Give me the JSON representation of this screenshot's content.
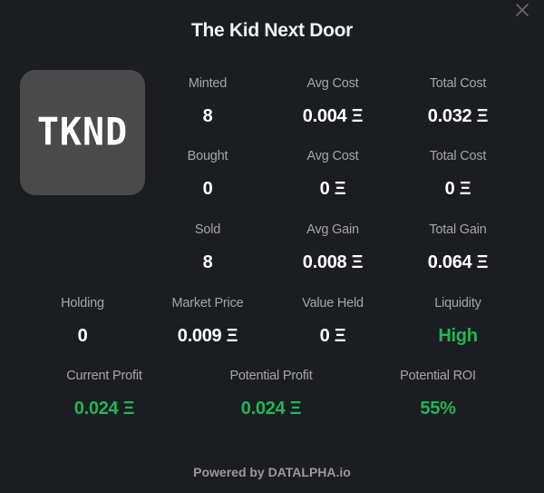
{
  "title": "The Kid Next Door",
  "logo_text": "TKND",
  "close_icon": "close-icon",
  "minted": {
    "count_label": "Minted",
    "count_value": "8",
    "avg_label": "Avg Cost",
    "avg_value": "0.004 Ξ",
    "total_label": "Total Cost",
    "total_value": "0.032 Ξ"
  },
  "bought": {
    "count_label": "Bought",
    "count_value": "0",
    "avg_label": "Avg Cost",
    "avg_value": "0 Ξ",
    "total_label": "Total Cost",
    "total_value": "0 Ξ"
  },
  "sold": {
    "count_label": "Sold",
    "count_value": "8",
    "avg_label": "Avg Gain",
    "avg_value": "0.008 Ξ",
    "total_label": "Total Gain",
    "total_value": "0.064 Ξ"
  },
  "holding": {
    "holding_label": "Holding",
    "holding_value": "0",
    "market_label": "Market Price",
    "market_value": "0.009 Ξ",
    "value_label": "Value Held",
    "value_value": "0 Ξ",
    "liquidity_label": "Liquidity",
    "liquidity_value": "High"
  },
  "profit": {
    "current_label": "Current Profit",
    "current_value": "0.024 Ξ",
    "potential_label": "Potential Profit",
    "potential_value": "0.024 Ξ",
    "roi_label": "Potential ROI",
    "roi_value": "55%"
  },
  "footer": "Powered by DATALPHA.io",
  "colors": {
    "background": "#1c1d20",
    "positive": "#1fb65a",
    "logo_bg": "#4a4a4a"
  }
}
